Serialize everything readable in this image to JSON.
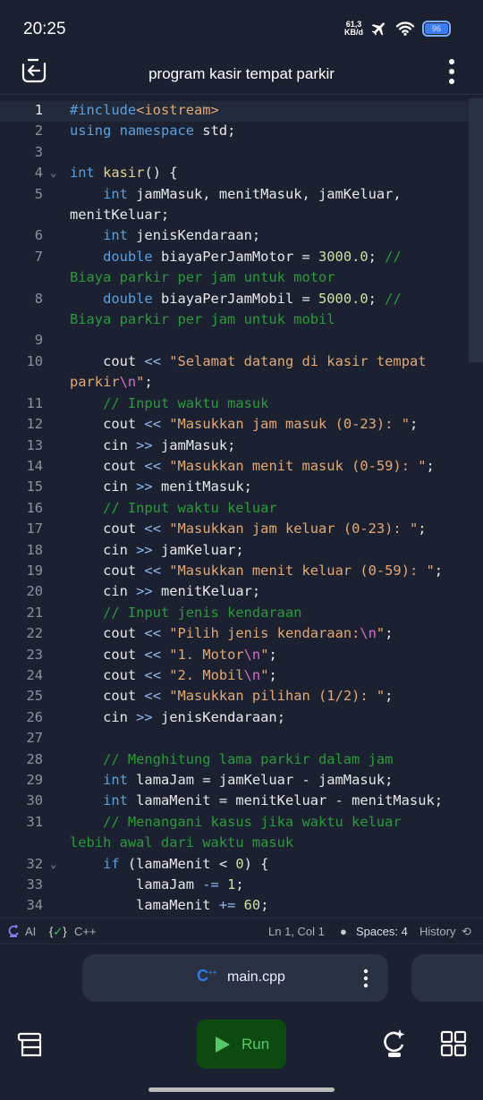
{
  "status_bar": {
    "time": "20:25",
    "net_speed_value": "61,3",
    "net_speed_unit": "KB/d",
    "battery": "96"
  },
  "header": {
    "title": "program kasir tempat parkir"
  },
  "editor": {
    "active_line": 1,
    "lines": [
      {
        "n": "1",
        "t": [
          [
            "k",
            "#include"
          ],
          [
            "s",
            "<iostream>"
          ]
        ]
      },
      {
        "n": "2",
        "t": [
          [
            "k",
            "using"
          ],
          [
            "p",
            " "
          ],
          [
            "k",
            "namespace"
          ],
          [
            "p",
            " std;"
          ]
        ]
      },
      {
        "n": "3",
        "t": []
      },
      {
        "n": "4",
        "fold": true,
        "t": [
          [
            "k",
            "int"
          ],
          [
            "p",
            " "
          ],
          [
            "f",
            "kasir"
          ],
          [
            "p",
            "() {"
          ]
        ]
      },
      {
        "n": "5",
        "t": [
          [
            "p",
            "    "
          ],
          [
            "k",
            "int"
          ],
          [
            "p",
            " jamMasuk, menitMasuk, jamKeluar, menitKeluar;"
          ]
        ]
      },
      {
        "n": "6",
        "t": [
          [
            "p",
            "    "
          ],
          [
            "k",
            "int"
          ],
          [
            "p",
            " jenisKendaraan;"
          ]
        ]
      },
      {
        "n": "7",
        "t": [
          [
            "p",
            "    "
          ],
          [
            "k",
            "double"
          ],
          [
            "p",
            " biayaPerJamMotor = "
          ],
          [
            "n",
            "3000.0"
          ],
          [
            "p",
            "; "
          ],
          [
            "c",
            "// Biaya parkir per jam untuk motor"
          ]
        ]
      },
      {
        "n": "8",
        "t": [
          [
            "p",
            "    "
          ],
          [
            "k",
            "double"
          ],
          [
            "p",
            " biayaPerJamMobil = "
          ],
          [
            "n",
            "5000.0"
          ],
          [
            "p",
            "; "
          ],
          [
            "c",
            "// Biaya parkir per jam untuk mobil"
          ]
        ]
      },
      {
        "n": "9",
        "t": []
      },
      {
        "n": "10",
        "t": [
          [
            "p",
            "    cout "
          ],
          [
            "o",
            "<<"
          ],
          [
            "p",
            " "
          ],
          [
            "s",
            "\"Selamat datang di kasir tempat parkir"
          ],
          [
            "e",
            "\\n"
          ],
          [
            "s",
            "\""
          ],
          [
            "p",
            ";"
          ]
        ]
      },
      {
        "n": "11",
        "t": [
          [
            "p",
            "    "
          ],
          [
            "c",
            "// Input waktu masuk"
          ]
        ]
      },
      {
        "n": "12",
        "t": [
          [
            "p",
            "    cout "
          ],
          [
            "o",
            "<<"
          ],
          [
            "p",
            " "
          ],
          [
            "s",
            "\"Masukkan jam masuk (0-23): \""
          ],
          [
            "p",
            ";"
          ]
        ]
      },
      {
        "n": "13",
        "t": [
          [
            "p",
            "    cin "
          ],
          [
            "o",
            ">>"
          ],
          [
            "p",
            " jamMasuk;"
          ]
        ]
      },
      {
        "n": "14",
        "t": [
          [
            "p",
            "    cout "
          ],
          [
            "o",
            "<<"
          ],
          [
            "p",
            " "
          ],
          [
            "s",
            "\"Masukkan menit masuk (0-59): \""
          ],
          [
            "p",
            ";"
          ]
        ]
      },
      {
        "n": "15",
        "t": [
          [
            "p",
            "    cin "
          ],
          [
            "o",
            ">>"
          ],
          [
            "p",
            " menitMasuk;"
          ]
        ]
      },
      {
        "n": "16",
        "t": [
          [
            "p",
            "    "
          ],
          [
            "c",
            "// Input waktu keluar"
          ]
        ]
      },
      {
        "n": "17",
        "t": [
          [
            "p",
            "    cout "
          ],
          [
            "o",
            "<<"
          ],
          [
            "p",
            " "
          ],
          [
            "s",
            "\"Masukkan jam keluar (0-23): \""
          ],
          [
            "p",
            ";"
          ]
        ]
      },
      {
        "n": "18",
        "t": [
          [
            "p",
            "    cin "
          ],
          [
            "o",
            ">>"
          ],
          [
            "p",
            " jamKeluar;"
          ]
        ]
      },
      {
        "n": "19",
        "t": [
          [
            "p",
            "    cout "
          ],
          [
            "o",
            "<<"
          ],
          [
            "p",
            " "
          ],
          [
            "s",
            "\"Masukkan menit keluar (0-59): \""
          ],
          [
            "p",
            ";"
          ]
        ]
      },
      {
        "n": "20",
        "t": [
          [
            "p",
            "    cin "
          ],
          [
            "o",
            ">>"
          ],
          [
            "p",
            " menitKeluar;"
          ]
        ]
      },
      {
        "n": "21",
        "t": [
          [
            "p",
            "    "
          ],
          [
            "c",
            "// Input jenis kendaraan"
          ]
        ]
      },
      {
        "n": "22",
        "t": [
          [
            "p",
            "    cout "
          ],
          [
            "o",
            "<<"
          ],
          [
            "p",
            " "
          ],
          [
            "s",
            "\"Pilih jenis kendaraan:"
          ],
          [
            "e",
            "\\n"
          ],
          [
            "s",
            "\""
          ],
          [
            "p",
            ";"
          ]
        ]
      },
      {
        "n": "23",
        "t": [
          [
            "p",
            "    cout "
          ],
          [
            "o",
            "<<"
          ],
          [
            "p",
            " "
          ],
          [
            "s",
            "\"1. Motor"
          ],
          [
            "e",
            "\\n"
          ],
          [
            "s",
            "\""
          ],
          [
            "p",
            ";"
          ]
        ]
      },
      {
        "n": "24",
        "t": [
          [
            "p",
            "    cout "
          ],
          [
            "o",
            "<<"
          ],
          [
            "p",
            " "
          ],
          [
            "s",
            "\"2. Mobil"
          ],
          [
            "e",
            "\\n"
          ],
          [
            "s",
            "\""
          ],
          [
            "p",
            ";"
          ]
        ]
      },
      {
        "n": "25",
        "t": [
          [
            "p",
            "    cout "
          ],
          [
            "o",
            "<<"
          ],
          [
            "p",
            " "
          ],
          [
            "s",
            "\"Masukkan pilihan (1/2): \""
          ],
          [
            "p",
            ";"
          ]
        ]
      },
      {
        "n": "26",
        "t": [
          [
            "p",
            "    cin "
          ],
          [
            "o",
            ">>"
          ],
          [
            "p",
            " jenisKendaraan;"
          ]
        ]
      },
      {
        "n": "27",
        "t": []
      },
      {
        "n": "28",
        "t": [
          [
            "p",
            "    "
          ],
          [
            "c",
            "// Menghitung lama parkir dalam jam"
          ]
        ]
      },
      {
        "n": "29",
        "t": [
          [
            "p",
            "    "
          ],
          [
            "k",
            "int"
          ],
          [
            "p",
            " lamaJam = jamKeluar - jamMasuk;"
          ]
        ]
      },
      {
        "n": "30",
        "t": [
          [
            "p",
            "    "
          ],
          [
            "k",
            "int"
          ],
          [
            "p",
            " lamaMenit = menitKeluar - menitMasuk;"
          ]
        ]
      },
      {
        "n": "31",
        "t": [
          [
            "p",
            "    "
          ],
          [
            "c",
            "// Menangani kasus jika waktu keluar lebih awal dari waktu masuk"
          ]
        ]
      },
      {
        "n": "32",
        "fold": true,
        "t": [
          [
            "p",
            "    "
          ],
          [
            "k",
            "if"
          ],
          [
            "p",
            " (lamaMenit < "
          ],
          [
            "n",
            "0"
          ],
          [
            "p",
            ") {"
          ]
        ]
      },
      {
        "n": "33",
        "t": [
          [
            "p",
            "        lamaJam "
          ],
          [
            "o",
            "-="
          ],
          [
            "p",
            " "
          ],
          [
            "n",
            "1"
          ],
          [
            "p",
            ";"
          ]
        ]
      },
      {
        "n": "34",
        "t": [
          [
            "p",
            "        lamaMenit "
          ],
          [
            "o",
            "+="
          ],
          [
            "p",
            " "
          ],
          [
            "n",
            "60"
          ],
          [
            "p",
            ";"
          ]
        ]
      }
    ]
  },
  "status_line": {
    "ai": "AI",
    "language": "C++",
    "cursor": "Ln 1, Col 1",
    "spaces": "Spaces: 4",
    "history": "History"
  },
  "file_tab": {
    "name": "main.cpp"
  },
  "bottom": {
    "run": "Run"
  },
  "colors": {
    "background": "#1b2130",
    "keyword": "#5aa0e0",
    "string": "#e3a873",
    "comment": "#2b9a3c",
    "number": "#cfe0a2",
    "run_bg": "#0c4a12",
    "run_fg": "#57c76a",
    "cpp_icon": "#2b7be8"
  }
}
